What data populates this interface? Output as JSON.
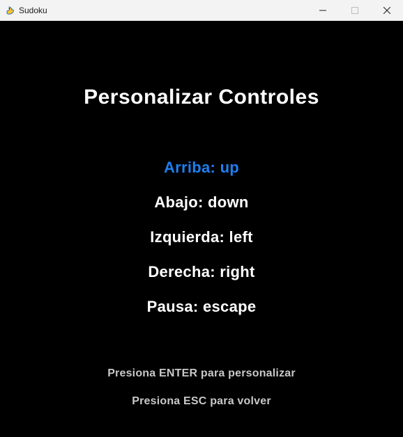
{
  "window": {
    "title": "Sudoku",
    "icon": "pygame-snake-icon",
    "background": "#000000"
  },
  "screen": {
    "heading": "Personalizar Controles",
    "controls": [
      {
        "label": "Arriba: up",
        "selected": true
      },
      {
        "label": "Abajo: down",
        "selected": false
      },
      {
        "label": "Izquierda: left",
        "selected": false
      },
      {
        "label": "Derecha: right",
        "selected": false
      },
      {
        "label": "Pausa: escape",
        "selected": false
      }
    ],
    "hints": [
      "Presiona ENTER para personalizar",
      "Presiona ESC para volver"
    ],
    "colors": {
      "selected": "#1e7ff0",
      "normal": "#ffffff",
      "hint": "#c8c8c8"
    }
  }
}
